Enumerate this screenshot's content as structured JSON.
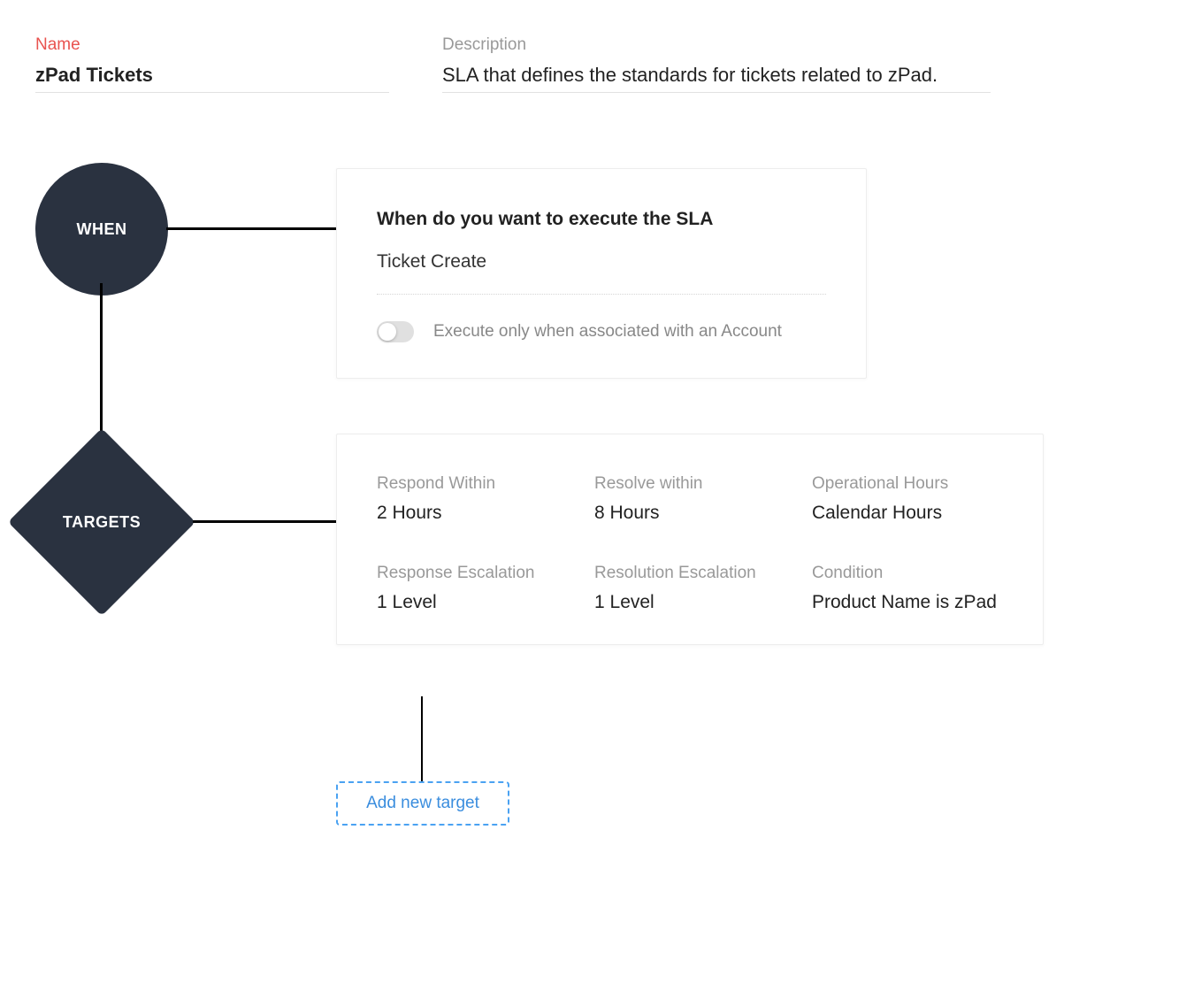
{
  "header": {
    "name_label": "Name",
    "name_value": "zPad Tickets",
    "desc_label": "Description",
    "desc_value": "SLA that defines the standards for tickets related to zPad."
  },
  "nodes": {
    "when_label": "WHEN",
    "targets_label": "TARGETS"
  },
  "when_card": {
    "title": "When do you want to execute the SLA",
    "trigger": "Ticket Create",
    "toggle_label": "Execute only when associated with an Account",
    "toggle_on": false
  },
  "targets_card": {
    "items": [
      {
        "label": "Respond Within",
        "value": "2 Hours"
      },
      {
        "label": "Resolve within",
        "value": "8 Hours"
      },
      {
        "label": "Operational Hours",
        "value": "Calendar Hours"
      },
      {
        "label": "Response Escalation",
        "value": "1 Level"
      },
      {
        "label": "Resolution Escalation",
        "value": "1 Level"
      },
      {
        "label": "Condition",
        "value": "Product Name is zPad"
      }
    ]
  },
  "add_target_label": "Add new target"
}
